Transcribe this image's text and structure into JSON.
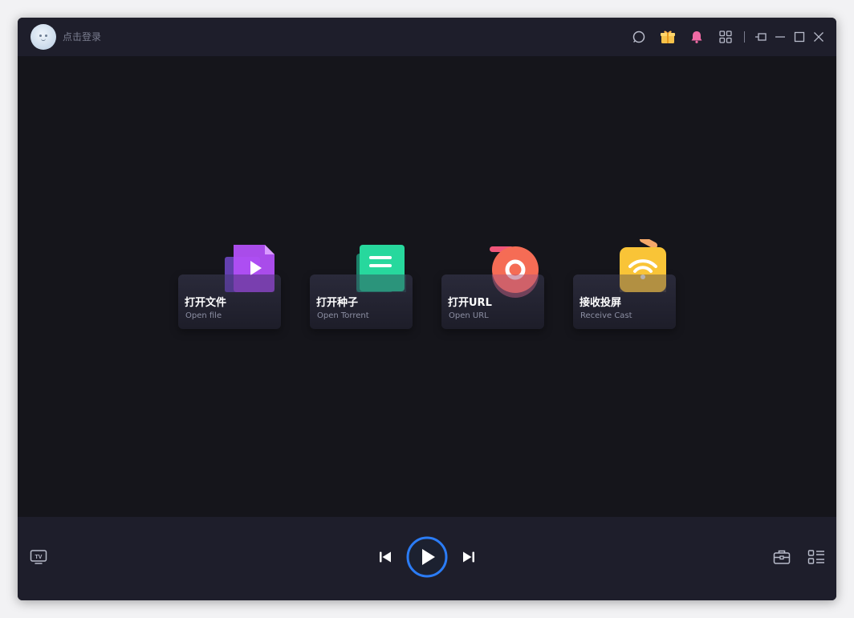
{
  "titlebar": {
    "login_text": "点击登录",
    "icons": [
      "search-icon",
      "gift-icon",
      "notification-bell-icon",
      "apps-grid-icon",
      "pin-icon",
      "minimize-icon",
      "maximize-icon",
      "close-icon"
    ]
  },
  "actions": [
    {
      "title": "打开文件",
      "subtitle": "Open file",
      "icon": "file-play-icon"
    },
    {
      "title": "打开种子",
      "subtitle": "Open Torrent",
      "icon": "torrent-doc-icon"
    },
    {
      "title": "打开URL",
      "subtitle": "Open URL",
      "icon": "url-link-icon"
    },
    {
      "title": "接收投屏",
      "subtitle": "Receive Cast",
      "icon": "cast-wifi-icon"
    }
  ],
  "player": {
    "left_icon": "tv-icon",
    "controls": [
      "previous-icon",
      "play-icon",
      "next-icon"
    ],
    "right_icons": [
      "toolbox-icon",
      "playlist-icon"
    ]
  },
  "colors": {
    "window_bg": "#15151b",
    "bar_bg": "#1e1e2b",
    "play_ring": "#2b7cf6",
    "file_icon": "#a34ef2",
    "torrent_icon": "#24d59a",
    "url_icon": "#f4665a",
    "cast_icon": "#f9c437"
  }
}
